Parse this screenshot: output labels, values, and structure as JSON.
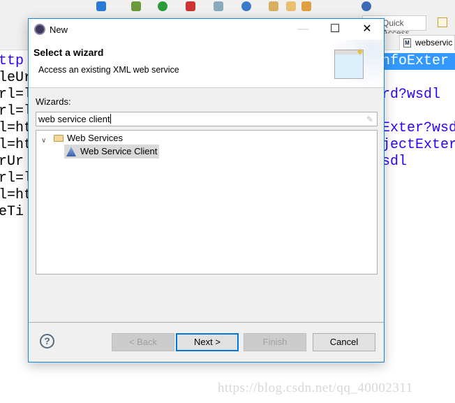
{
  "ide": {
    "quick_access": "Quick Access",
    "editor_tab": "webservic",
    "code_left": [
      "ttp",
      "leUr",
      "rl=l",
      "rl=l",
      "l=ht",
      "l=ht",
      "rUr",
      "rl=l",
      "l=ht",
      "eTi"
    ],
    "code_right": [
      "",
      "nfoExter",
      "",
      "rd?wsdl",
      "",
      "Exter?wsd",
      "jectExter",
      "sdl",
      "",
      ""
    ],
    "watermark": "https://blog.csdn.net/qq_40002311"
  },
  "dialog": {
    "title": "New",
    "header_title": "Select a wizard",
    "header_desc": "Access an existing XML web service",
    "wizards_label": "Wizards:",
    "filter_value": "web service client",
    "tree": {
      "folder": "Web Services",
      "item": "Web Service Client"
    },
    "buttons": {
      "back": "< Back",
      "next": "Next >",
      "finish": "Finish",
      "cancel": "Cancel"
    },
    "help": "?",
    "accent": "#0078d7"
  }
}
